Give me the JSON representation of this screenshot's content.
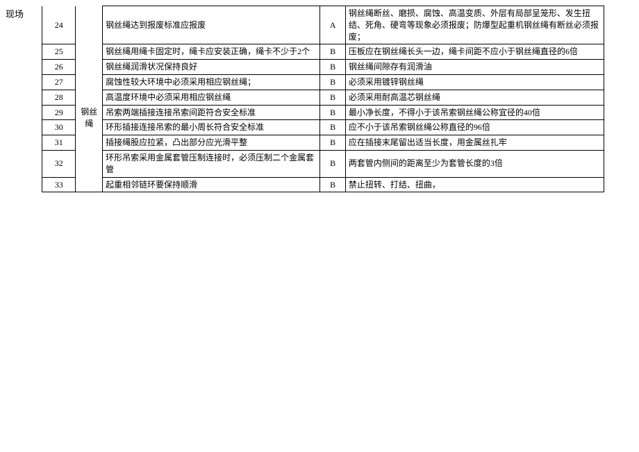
{
  "sideLabel": "现场",
  "category": "钢丝绳",
  "rows": [
    {
      "num": "24",
      "desc": "钢丝绳达到报废标准应报废",
      "grade": "A",
      "note": "钢丝绳断丝、磨损、腐蚀、高温变质、外层有局部呈笼形、发生扭结、死角、硬弯等现象必须报废；防爆型起重机钢丝绳有断丝必须报废；"
    },
    {
      "num": "25",
      "desc": "钢丝绳用绳卡固定时，绳卡应安装正确，绳卡不少于2个",
      "grade": "B",
      "note": "压板应在钢丝绳长头一边，绳卡间距不应小于钢丝绳直径的6倍"
    },
    {
      "num": "26",
      "desc": "钢丝绳润滑状况保持良好",
      "grade": "B",
      "note": "钢丝绳间隙存有润滑油"
    },
    {
      "num": "27",
      "desc": "腐蚀性较大环境中必须采用相应钢丝绳；",
      "grade": "B",
      "note": "必须采用镀锌钢丝绳"
    },
    {
      "num": "28",
      "desc": "高温度环境中必须采用相应钢丝绳",
      "grade": "B",
      "note": "必须采用耐高温芯钢丝绳"
    },
    {
      "num": "29",
      "desc": "吊索两端插接连接吊索间距符合安全标准",
      "grade": "B",
      "note": "最小净长度，不得小于该吊索钢丝绳公称宜径的40倍"
    },
    {
      "num": "30",
      "desc": "环形插接连接吊索的最小周长符合安全标准",
      "grade": "B",
      "note": "应不小于该吊索钢丝绳公称直径的96倍"
    },
    {
      "num": "31",
      "desc": "插接绳股应拉紧，凸出部分应光滑平整",
      "grade": "B",
      "note": "应在插接末尾留出适当长度，用金属丝扎牢"
    },
    {
      "num": "32",
      "desc": "环形吊索采用金属套管压制连接时，必须压制二个金属套管",
      "grade": "B",
      "note": "两套管内侧间的距离至少为套管长度的3倍"
    },
    {
      "num": "33",
      "desc": "起重相邻链环要保持顺滑",
      "grade": "B",
      "note": "禁止扭转、打结、扭曲，"
    }
  ]
}
